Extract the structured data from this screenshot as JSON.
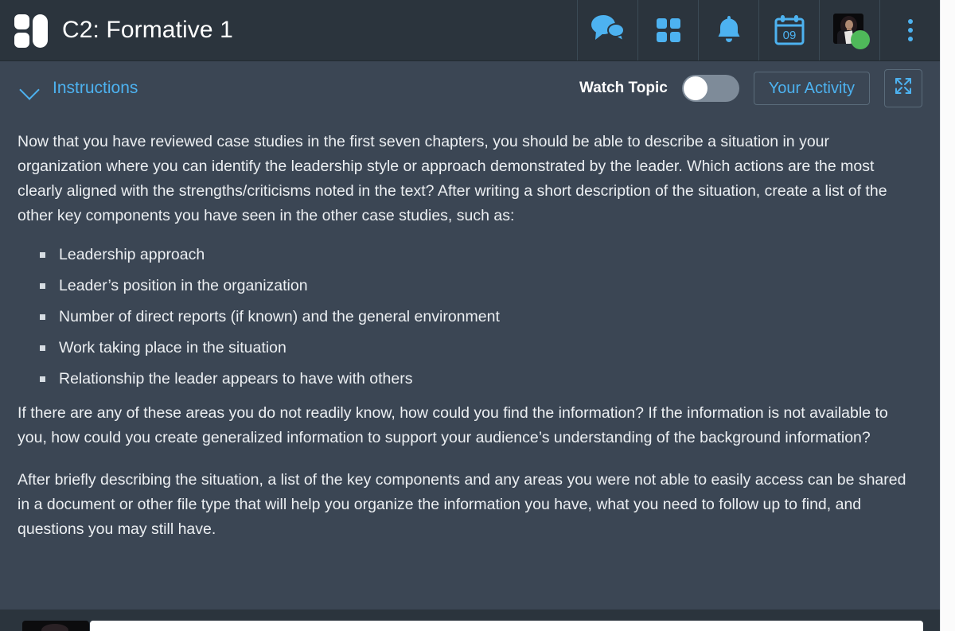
{
  "header": {
    "logo_icon": "app-logo-icon",
    "title": "C2: Formative 1",
    "actions": [
      {
        "name": "chat-icon",
        "label": "Chat"
      },
      {
        "name": "apps-grid-icon",
        "label": "Apps"
      },
      {
        "name": "bell-icon",
        "label": "Notifications"
      },
      {
        "name": "calendar-icon",
        "label": "Calendar",
        "badge": "09"
      },
      {
        "name": "avatar",
        "label": "Profile",
        "status": "online"
      },
      {
        "name": "kebab-menu-icon",
        "label": "More options"
      }
    ]
  },
  "toolbar": {
    "collapse_icon": "chevron-down-icon",
    "instructions_label": "Instructions",
    "watch_topic_label": "Watch Topic",
    "watch_topic_state": "off",
    "your_activity_label": "Your Activity",
    "expand_icon": "expand-fullscreen-icon"
  },
  "instructions": {
    "paragraph_1": "Now that you have reviewed case studies in the first seven chapters, you should be able to describe a situation in your organization where you can identify the leadership style or approach demonstrated by the leader. Which actions are the most clearly aligned with the strengths/criticisms noted in the text? After writing a short description of the situation, create a list of the other key components you have seen in the other case studies, such as:",
    "bullets": [
      "Leadership approach",
      "Leader’s position in the organization",
      "Number of direct reports (if known) and the general environment",
      "Work taking place in the situation",
      "Relationship the leader appears to have with others"
    ],
    "paragraph_2": "If there are any of these areas you do not readily know, how could you find the information? If the information is not available to you, how could you create generalized information to support your audience’s understanding of the background information?",
    "paragraph_3": "After briefly describing the situation, a list of the key components and any areas you were not able to easily access can be shared in a document or other file type that will help you organize the information you have, what you need to follow up to find, and questions you may still have."
  },
  "colors": {
    "header_bg": "#2b343d",
    "body_bg": "#3b4654",
    "accent": "#4db2f0",
    "text": "#eceff2",
    "status_green": "#4fb95a",
    "toggle_track": "#7e8b99"
  }
}
